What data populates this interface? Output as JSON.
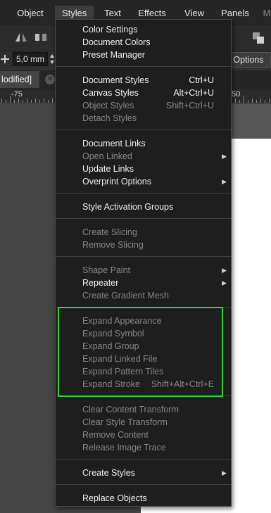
{
  "menubar": {
    "items": [
      {
        "label": "Object"
      },
      {
        "label": "Styles"
      },
      {
        "label": "Text"
      },
      {
        "label": "Effects"
      },
      {
        "label": "View"
      },
      {
        "label": "Panels"
      },
      {
        "label": "M"
      }
    ]
  },
  "toolbar": {
    "size_value": "5,0 mm",
    "options_label": "d Options"
  },
  "document_tab": {
    "label": "lodified]"
  },
  "ruler": {
    "labels": [
      "-75",
      "50"
    ]
  },
  "styles_menu": {
    "groups": [
      [
        {
          "label": "Color Settings",
          "enabled": true
        },
        {
          "label": "Document Colors",
          "enabled": true
        },
        {
          "label": "Preset Manager",
          "enabled": true
        }
      ],
      [
        {
          "label": "Document Styles",
          "shortcut": "Ctrl+U",
          "enabled": true
        },
        {
          "label": "Canvas Styles",
          "shortcut": "Alt+Ctrl+U",
          "enabled": true
        },
        {
          "label": "Object Styles",
          "shortcut": "Shift+Ctrl+U",
          "enabled": false
        },
        {
          "label": "Detach Styles",
          "enabled": false
        }
      ],
      [
        {
          "label": "Document Links",
          "enabled": true
        },
        {
          "label": "Open Linked",
          "enabled": false,
          "submenu": true
        },
        {
          "label": "Update Links",
          "enabled": true
        },
        {
          "label": "Overprint Options",
          "enabled": true,
          "submenu": true
        }
      ],
      [
        {
          "label": "Style Activation Groups",
          "enabled": true
        }
      ],
      [
        {
          "label": "Create Slicing",
          "enabled": false
        },
        {
          "label": "Remove Slicing",
          "enabled": false
        }
      ],
      [
        {
          "label": "Shape Paint",
          "enabled": false,
          "submenu": true
        },
        {
          "label": "Repeater",
          "enabled": true,
          "submenu": true
        },
        {
          "label": "Create Gradient Mesh",
          "enabled": false
        }
      ],
      [
        {
          "label": "Expand Appearance",
          "enabled": false
        },
        {
          "label": "Expand Symbol",
          "enabled": false
        },
        {
          "label": "Expand Group",
          "enabled": false
        },
        {
          "label": "Expand Linked File",
          "enabled": false
        },
        {
          "label": "Expand Pattern Tiles",
          "enabled": false
        },
        {
          "label": "Expand Stroke",
          "shortcut": "Shift+Alt+Ctrl+E",
          "enabled": false
        }
      ],
      [
        {
          "label": "Clear Content Transform",
          "enabled": false
        },
        {
          "label": "Clear Style Transform",
          "enabled": false
        },
        {
          "label": "Remove Content",
          "enabled": false
        },
        {
          "label": "Release Image Trace",
          "enabled": false
        }
      ],
      [
        {
          "label": "Create Styles",
          "enabled": true,
          "submenu": true
        }
      ],
      [
        {
          "label": "Replace Objects",
          "enabled": true
        }
      ]
    ]
  },
  "colors": {
    "highlight": "#27d43a",
    "menu_bg": "#1e1e1e",
    "enabled_text": "#efefef",
    "disabled_text": "#868686"
  }
}
